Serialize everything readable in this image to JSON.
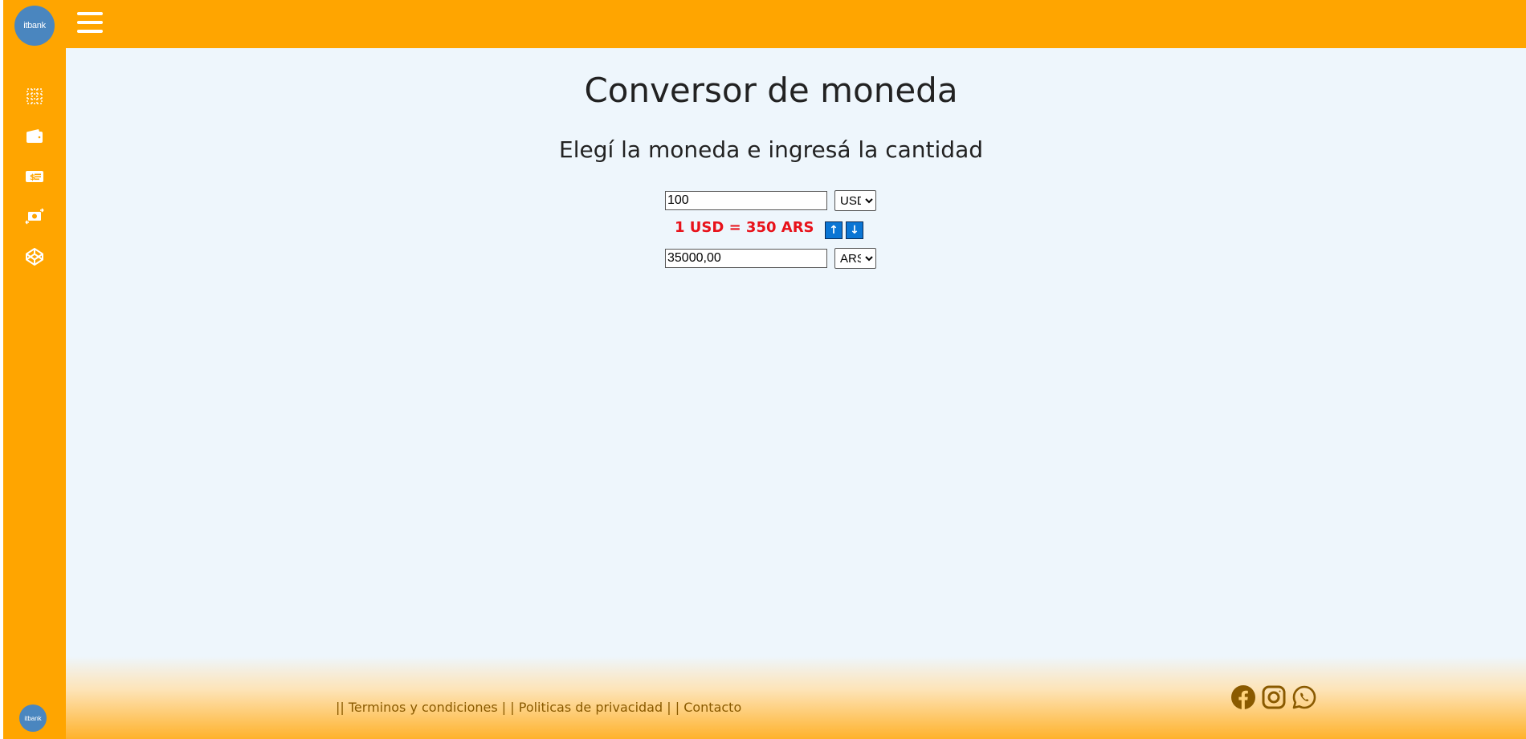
{
  "brand": {
    "logo_text": "itbank"
  },
  "header": {
    "menu_icon": "hamburger-menu-icon"
  },
  "sidebar": {
    "items": [
      {
        "icon": "grid-icon"
      },
      {
        "icon": "wallet-icon"
      },
      {
        "icon": "dollar-card-icon"
      },
      {
        "icon": "currency-exchange-icon"
      },
      {
        "icon": "codepen-icon"
      }
    ]
  },
  "main": {
    "title": "Conversor de moneda",
    "subtitle": "Elegí la moneda e ingresá la cantidad",
    "from": {
      "value": "100",
      "currency": "USD",
      "options": [
        "USD"
      ]
    },
    "rate_text": "1 USD = 350 ARS",
    "swap_up_label": "↑",
    "swap_down_label": "↓",
    "to": {
      "value": "35000,00",
      "currency": "ARS",
      "options": [
        "ARS"
      ]
    }
  },
  "footer": {
    "links": [
      {
        "prefix": "|| ",
        "label": "Terminos y condiciones",
        "suffix": " | "
      },
      {
        "prefix": " | ",
        "label": "Politicas de privacidad",
        "suffix": " | "
      },
      {
        "prefix": " | ",
        "label": "Contacto",
        "suffix": ""
      }
    ],
    "socials": [
      "facebook-icon",
      "instagram-icon",
      "whatsapp-icon"
    ],
    "link_color": "#8a5a00"
  },
  "colors": {
    "accent": "#ffa500",
    "background": "#eef6fc",
    "rate": "#e8121a",
    "button": "#0a75d4"
  }
}
